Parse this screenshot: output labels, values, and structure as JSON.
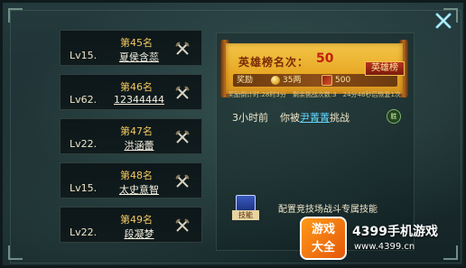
{
  "ranking": [
    {
      "rank_title": "第45名",
      "level": "Lv15.",
      "name": "夏侯含蕊"
    },
    {
      "rank_title": "第46名",
      "level": "Lv62.",
      "name": "12344444"
    },
    {
      "rank_title": "第47名",
      "level": "Lv22.",
      "name": "洪涵蕾"
    },
    {
      "rank_title": "第48名",
      "level": "Lv15.",
      "name": "太史意智"
    },
    {
      "rank_title": "第49名",
      "level": "Lv22.",
      "name": "段凝梦"
    }
  ],
  "hero_scroll": {
    "title": "英雄榜名次：",
    "rank": "50",
    "reward_label": "奖励",
    "coin_value": "35两",
    "token_value": "500",
    "hero_button": "英雄榜",
    "info_line": "奖励倒计时:28时3分　剩余挑战次数:3　24分46秒后恢复1次"
  },
  "battle_log": {
    "time": "3小时前",
    "prefix": "你被",
    "challenger": "尹菁菁",
    "suffix": "挑战",
    "result": "胜"
  },
  "skill": {
    "book_label": "技能",
    "text": "配置竞技场战斗专属技能"
  },
  "promo": {
    "logo_line1": "游戏",
    "logo_line2": "大全",
    "title": "4399手机游戏",
    "url": "www.4399.cn"
  },
  "colors": {
    "accent_gold": "#f4c860",
    "rank_red": "#c21e0f",
    "link_blue": "#62d7ff"
  }
}
